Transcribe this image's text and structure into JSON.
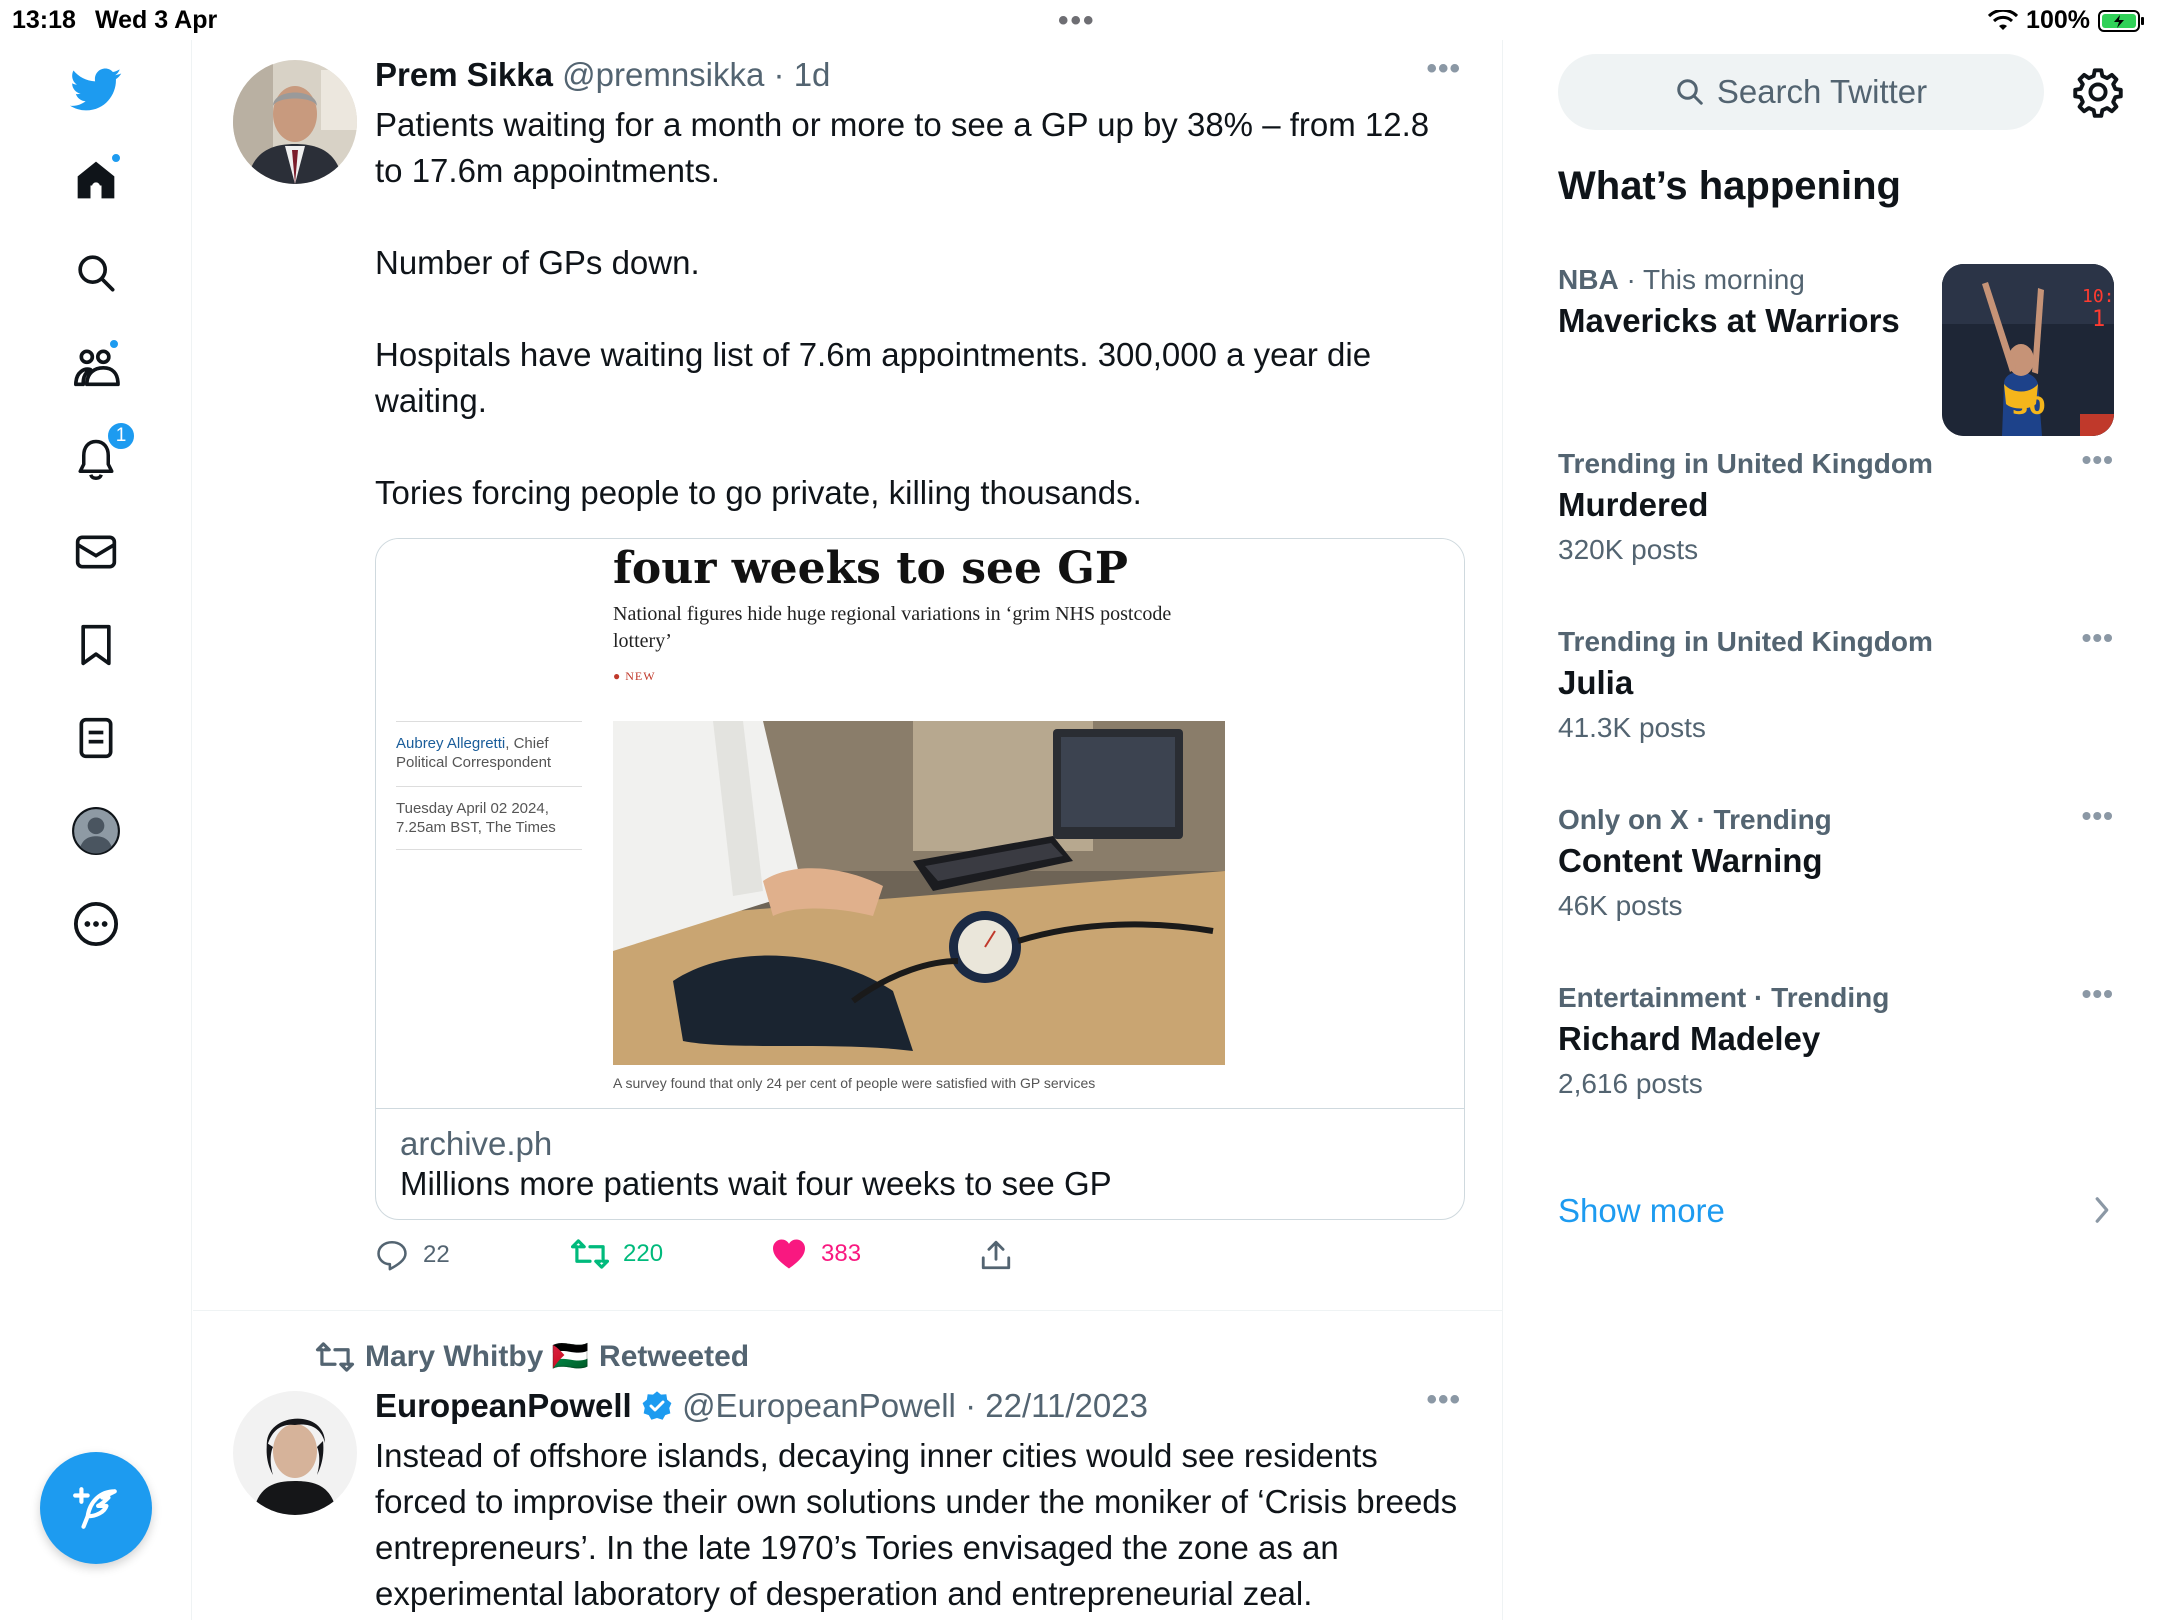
{
  "status_bar": {
    "time": "13:18",
    "date": "Wed 3 Apr",
    "battery": "100%"
  },
  "nav": {
    "notifications_badge": "1",
    "icons": [
      "twitter-logo-icon",
      "home-icon",
      "search-icon",
      "communities-icon",
      "bell-icon",
      "mail-icon",
      "bookmark-icon",
      "lists-icon",
      "profile-icon",
      "more-icon",
      "compose-icon"
    ]
  },
  "tweet1": {
    "name": "Prem Sikka",
    "handle": "@premnsikka",
    "time": "· 1d",
    "paragraphs": [
      "Patients waiting for a month or more to see a GP up by 38% – from 12.8 to 17.6m appointments.",
      "Number of GPs down.",
      "Hospitals have waiting list of 7.6m appointments. 300,000 a year die waiting.",
      "Tories forcing people to go private, killing thousands."
    ],
    "card": {
      "headline": "four weeks to see GP",
      "subhead": "National figures hide huge regional variations in ‘grim NHS postcode lottery’",
      "new_tag": "● NEW",
      "author": "Aubrey Allegretti",
      "author_role": ", Chief Political Correspondent",
      "date_line": "Tuesday April 02 2024, 7.25am BST, The Times",
      "caption": "A survey found that only 24 per cent of people were satisfied with GP services",
      "domain": "archive.ph",
      "title": "Millions more patients wait four weeks to see GP"
    },
    "replies": "22",
    "retweets": "220",
    "likes": "383"
  },
  "tweet2": {
    "retweeted_by": "Mary Whitby 🇵🇸",
    "retweeted_label": "Retweeted",
    "name": "EuropeanPowell",
    "handle": "@EuropeanPowell",
    "time": "· 22/11/2023",
    "text": "Instead of offshore islands, decaying inner cities would see residents forced to improvise their own solutions under the moniker of ‘Crisis breeds entrepreneurs’. In the late 1970’s Tories envisaged the zone as an experimental laboratory of desperation and entrepreneurial zeal."
  },
  "sidebar": {
    "search_placeholder": "Search Twitter",
    "whats_happening": "What’s happening",
    "trends": [
      {
        "context_bold": "NBA",
        "context": " · This morning",
        "name": "Mavericks at Warriors",
        "count": ""
      },
      {
        "context_bold": "Trending in United Kingdom",
        "context": "",
        "name": "Murdered",
        "count": "320K posts"
      },
      {
        "context_bold": "Trending in United Kingdom",
        "context": "",
        "name": "Julia",
        "count": "41.3K posts"
      },
      {
        "context_bold": "Only on X · Trending",
        "context": "",
        "name": "Content Warning",
        "count": "46K posts"
      },
      {
        "context_bold": "Entertainment · Trending",
        "context": "",
        "name": "Richard Madeley",
        "count": "2,616 posts"
      }
    ],
    "show_more": "Show more"
  },
  "colors": {
    "accent": "#1d9bf0",
    "retweet_green": "#00ba7c",
    "like_pink": "#f91880",
    "secondary_text": "#536471"
  }
}
